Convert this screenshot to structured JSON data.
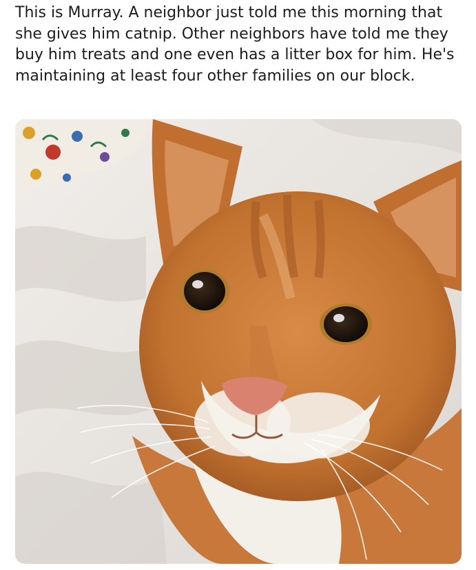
{
  "post": {
    "text": "This is Murray. A neighbor just told me this morning that she gives him catnip. Other neighbors have told me they buy him treats and one even has a litter box for him. He's maintaining at least four other families on our block."
  },
  "photo": {
    "subject": "orange-tabby-cat",
    "colors": {
      "fur": "#c9793a",
      "fur_light": "#e3a062",
      "fur_dark": "#9c5522",
      "white_fur": "#f3efe9",
      "nose": "#d9826f",
      "eyes": "#2a1b10",
      "blanket": "#ebe8e5",
      "blanket_shadow": "#cdc8c3"
    }
  }
}
